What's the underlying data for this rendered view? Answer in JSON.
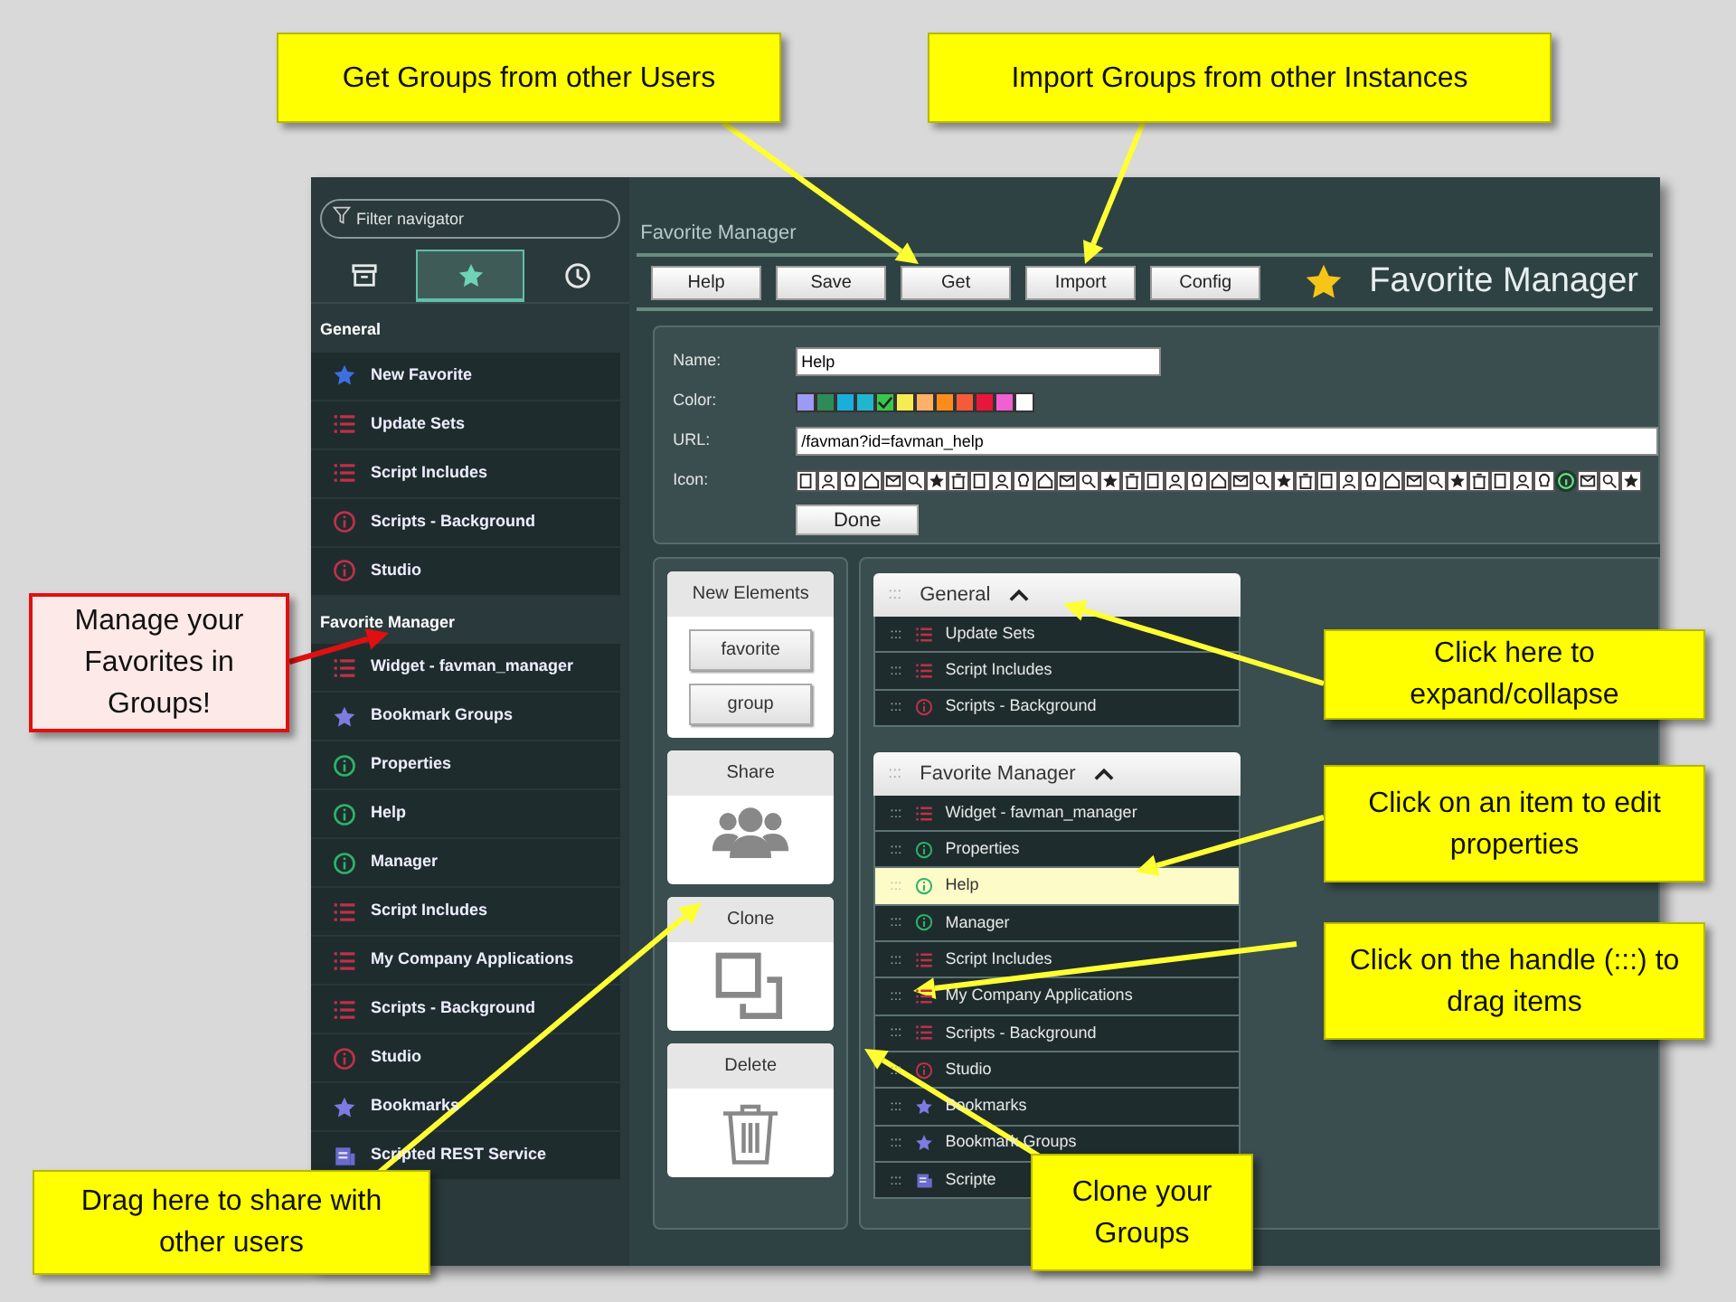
{
  "callouts": [
    {
      "text": "Get Groups from other Users",
      "kind": "note"
    },
    {
      "text": "Import Groups from other Instances",
      "kind": "note"
    },
    {
      "text": "Manage your Favorites in Groups!",
      "kind": "alert"
    },
    {
      "text": "Click here to expand/collapse",
      "kind": "note"
    },
    {
      "text": "Click on an item to edit properties",
      "kind": "note"
    },
    {
      "text": "Click on the handle (:::) to drag items",
      "kind": "note"
    },
    {
      "text": "Drag here to share with other users",
      "kind": "note"
    },
    {
      "text": "Clone your Groups",
      "kind": "note"
    }
  ],
  "sidebar": {
    "filter": {
      "placeholder": "Filter navigator"
    },
    "tabs": [
      {
        "kind": "archive",
        "selected": false
      },
      {
        "kind": "star",
        "selected": true
      },
      {
        "kind": "clock",
        "selected": false
      }
    ],
    "sections": [
      {
        "title": "General",
        "items": [
          {
            "label": "New Favorite",
            "kind": "star",
            "color": "#3d6fe0"
          },
          {
            "label": "Update Sets",
            "kind": "list",
            "color": "#c0304a"
          },
          {
            "label": "Script Includes",
            "kind": "list",
            "color": "#c0304a"
          },
          {
            "label": "Scripts - Background",
            "kind": "info",
            "color": "#c0304a"
          },
          {
            "label": "Studio",
            "kind": "info",
            "color": "#c0304a"
          }
        ]
      },
      {
        "title": "Favorite Manager",
        "items": [
          {
            "label": "Widget - favman_manager",
            "kind": "list",
            "color": "#c0304a"
          },
          {
            "label": "Bookmark Groups",
            "kind": "star",
            "color": "#7c7ce0"
          },
          {
            "label": "Properties",
            "kind": "info",
            "color": "#2db36b"
          },
          {
            "label": "Help",
            "kind": "info",
            "color": "#2db36b"
          },
          {
            "label": "Manager",
            "kind": "info",
            "color": "#2db36b"
          },
          {
            "label": "Script Includes",
            "kind": "list",
            "color": "#c0304a"
          },
          {
            "label": "My Company Applications",
            "kind": "list",
            "color": "#c0304a"
          },
          {
            "label": "Scripts - Background",
            "kind": "list",
            "color": "#c0304a"
          },
          {
            "label": "Studio",
            "kind": "info",
            "color": "#c0304a"
          },
          {
            "label": "Bookmarks",
            "kind": "star",
            "color": "#7c7ce0"
          },
          {
            "label": "Scripted REST Service",
            "kind": "doc",
            "color": "#6a6ad0"
          }
        ]
      }
    ]
  },
  "main": {
    "title": "Favorite Manager",
    "buttons": [
      "Help",
      "Save",
      "Get",
      "Import",
      "Config"
    ],
    "heading": "Favorite Manager",
    "form": {
      "name_label": "Name:",
      "name_value": "Help",
      "color_label": "Color:",
      "swatches": [
        {
          "color": "#9b9bf5",
          "selected": false
        },
        {
          "color": "#2e8b57",
          "selected": false
        },
        {
          "color": "#1aafdb",
          "selected": false
        },
        {
          "color": "#22b5d0",
          "selected": false
        },
        {
          "color": "#37c84a",
          "selected": true
        },
        {
          "color": "#f5ec52",
          "selected": false
        },
        {
          "color": "#ffb067",
          "selected": false
        },
        {
          "color": "#ff8c1a",
          "selected": false
        },
        {
          "color": "#f55b3a",
          "selected": false
        },
        {
          "color": "#e8173a",
          "selected": false
        },
        {
          "color": "#f060d0",
          "selected": false
        },
        {
          "color": "#ffffff",
          "selected": false
        }
      ],
      "url_label": "URL:",
      "url_value": "/favman?id=favman_help",
      "icon_label": "Icon:",
      "icon_options": [
        {
          "selected": false
        },
        {
          "selected": false
        },
        {
          "selected": false
        },
        {
          "selected": false
        },
        {
          "selected": false
        },
        {
          "selected": false
        },
        {
          "selected": false
        },
        {
          "selected": false
        },
        {
          "selected": false
        },
        {
          "selected": false
        },
        {
          "selected": false
        },
        {
          "selected": false
        },
        {
          "selected": false
        },
        {
          "selected": false
        },
        {
          "selected": false
        },
        {
          "selected": false
        },
        {
          "selected": false
        },
        {
          "selected": false
        },
        {
          "selected": false
        },
        {
          "selected": false
        },
        {
          "selected": false
        },
        {
          "selected": false
        },
        {
          "selected": false
        },
        {
          "selected": false
        },
        {
          "selected": false
        },
        {
          "selected": false
        },
        {
          "selected": false
        },
        {
          "selected": false
        },
        {
          "selected": false
        },
        {
          "selected": false
        },
        {
          "selected": false
        },
        {
          "selected": false
        },
        {
          "selected": false
        },
        {
          "selected": false
        },
        {
          "selected": false
        },
        {
          "selected": true
        },
        {
          "selected": false
        },
        {
          "selected": false
        },
        {
          "selected": false
        }
      ],
      "done": "Done"
    },
    "new_elements": {
      "title": "New Elements",
      "buttons": [
        "favorite",
        "group"
      ]
    },
    "actions": [
      {
        "title": "Share",
        "kind": "share"
      },
      {
        "title": "Clone",
        "kind": "clone"
      },
      {
        "title": "Delete",
        "kind": "delete"
      }
    ],
    "groups": [
      {
        "title": "General",
        "handle": ":::",
        "expanded": true,
        "items": [
          {
            "handle": ":::",
            "label": "Update Sets",
            "kind": "list",
            "color": "#c0304a",
            "selected": false
          },
          {
            "handle": ":::",
            "label": "Script Includes",
            "kind": "list",
            "color": "#c0304a",
            "selected": false
          },
          {
            "handle": ":::",
            "label": "Scripts - Background",
            "kind": "info",
            "color": "#c0304a",
            "selected": false
          }
        ]
      },
      {
        "title": "Favorite Manager",
        "handle": ":::",
        "expanded": true,
        "items": [
          {
            "handle": ":::",
            "label": "Widget - favman_manager",
            "kind": "list",
            "color": "#c0304a",
            "selected": false
          },
          {
            "handle": ":::",
            "label": "Properties",
            "kind": "info",
            "color": "#2db36b",
            "selected": false
          },
          {
            "handle": ":::",
            "label": "Help",
            "kind": "info",
            "color": "#2db36b",
            "selected": true
          },
          {
            "handle": ":::",
            "label": "Manager",
            "kind": "info",
            "color": "#2db36b",
            "selected": false
          },
          {
            "handle": ":::",
            "label": "Script Includes",
            "kind": "list",
            "color": "#c0304a",
            "selected": false
          },
          {
            "handle": ":::",
            "label": "My Company Applications",
            "kind": "list",
            "color": "#c0304a",
            "selected": false
          },
          {
            "handle": ":::",
            "label": "Scripts - Background",
            "kind": "list",
            "color": "#c0304a",
            "selected": false
          },
          {
            "handle": ":::",
            "label": "Studio",
            "kind": "info",
            "color": "#c0304a",
            "selected": false
          },
          {
            "handle": ":::",
            "label": "Bookmarks",
            "kind": "star",
            "color": "#7c7ce0",
            "selected": false
          },
          {
            "handle": ":::",
            "label": "Bookmark Groups",
            "kind": "star",
            "color": "#7c7ce0",
            "selected": false
          },
          {
            "handle": ":::",
            "label": "Scripte",
            "kind": "doc",
            "color": "#6a6ad0",
            "selected": false
          }
        ]
      }
    ]
  }
}
